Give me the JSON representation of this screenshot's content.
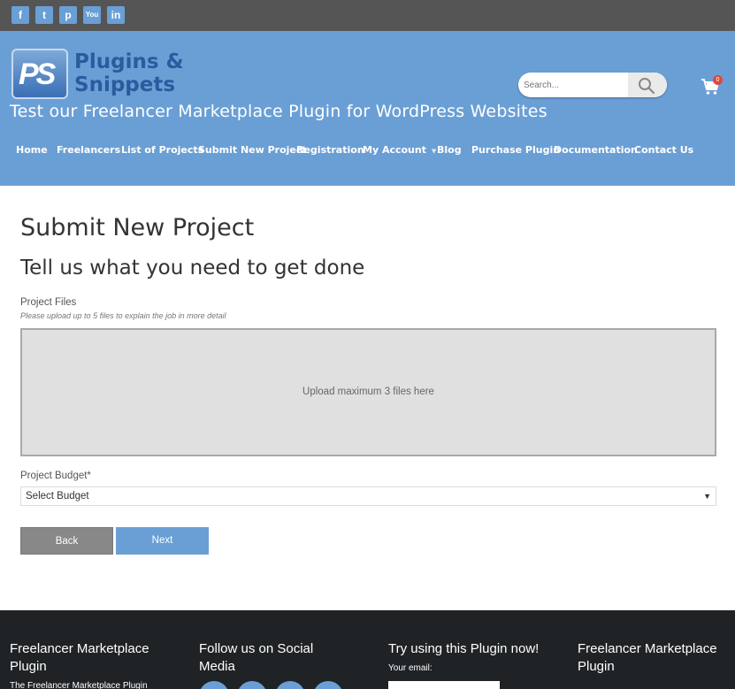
{
  "social": [
    {
      "name": "facebook",
      "glyph": "f"
    },
    {
      "name": "twitter",
      "glyph": "t"
    },
    {
      "name": "pinterest",
      "glyph": "p"
    },
    {
      "name": "youtube",
      "glyph": "You"
    },
    {
      "name": "linkedin",
      "glyph": "in"
    }
  ],
  "header": {
    "logo_mark": "PS",
    "logo_line1": "Plugins &",
    "logo_line2": "Snippets",
    "tagline": "Test our Freelancer Marketplace Plugin for WordPress Websites",
    "search_placeholder": "Search...",
    "cart_count": "0"
  },
  "nav": [
    "Home",
    "Freelancers",
    "List of Projects",
    "Submit New Project",
    "Registration",
    "My Account",
    "Blog",
    "Purchase Plugin",
    "Documentation",
    "Contact Us"
  ],
  "content": {
    "page_title": "Submit New Project",
    "section_title": "Tell us what you need to get done",
    "files_label": "Project Files",
    "files_hint": "Please upload up to 5 files to explain the job in more detail",
    "dropzone_text": "Upload maximum 3 files here",
    "budget_label": "Project Budget*",
    "budget_selected": "Select Budget",
    "back_label": "Back",
    "next_label": "Next"
  },
  "footer": {
    "col1_title": "Freelancer Marketplace Plugin",
    "col1_text": "The Freelancer Marketplace Plugin",
    "col2_title": "Follow us on Social Media",
    "col3_title": "Try using this Plugin now!",
    "col3_email_label": "Your email:",
    "col4_title": "Freelancer Marketplace Plugin"
  },
  "colors": {
    "brand_blue": "#6a9fd6",
    "top_bar": "#555555",
    "footer_bg": "#1f2326",
    "back_button": "#888888"
  }
}
